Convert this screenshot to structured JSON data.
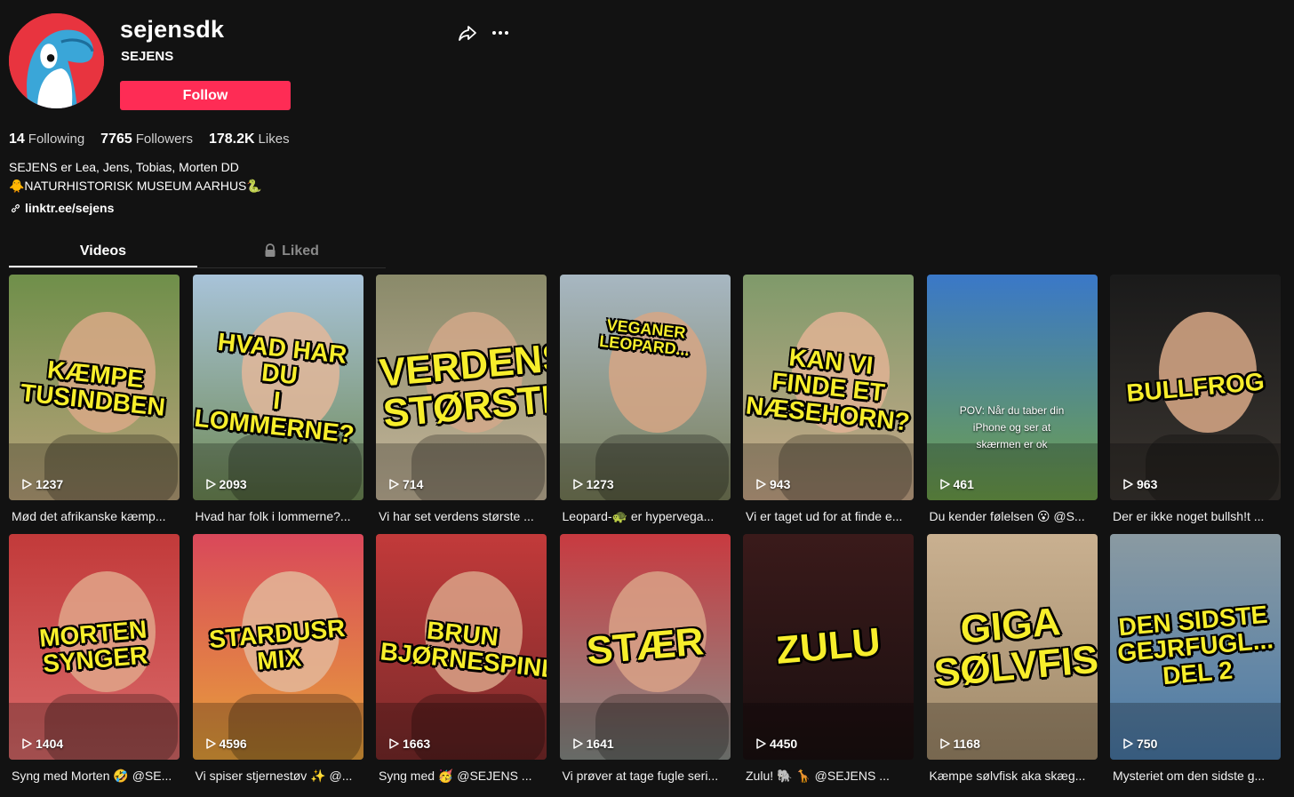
{
  "profile": {
    "username": "sejensdk",
    "nickname": "SEJENS",
    "follow_label": "Follow",
    "following_count": "14",
    "following_label": "Following",
    "followers_count": "7765",
    "followers_label": "Followers",
    "likes_count": "178.2K",
    "likes_label": "Likes",
    "bio_line1": "SEJENS er Lea, Jens, Tobias, Morten DD",
    "bio_line2": "🐥NATURHISTORISK MUSEUM AARHUS🐍",
    "link": "linktr.ee/sejens"
  },
  "tabs": {
    "videos": "Videos",
    "liked": "Liked"
  },
  "colors": {
    "accent": "#fe2c55",
    "background": "#121212",
    "overlay_text": "#f7ee2b"
  },
  "videos": [
    {
      "overlay": "KÆMPE\nTUSINDBEN",
      "views": "1237",
      "desc": "Mød det afrikanske kæmp..."
    },
    {
      "overlay": "HVAD HAR DU\nI LOMMERNE?",
      "views": "2093",
      "desc": "Hvad har folk i lommerne?..."
    },
    {
      "overlay": "VERDENS\nSTØRSTE!!!",
      "views": "714",
      "desc": "Vi har set verdens største ..."
    },
    {
      "overlay": "VEGANER\nLEOPARD...",
      "views": "1273",
      "desc": "Leopard-🐢 er hypervega..."
    },
    {
      "overlay": "KAN VI FINDE ET\nNÆSEHORN?",
      "views": "943",
      "desc": "Vi er taget ud for at finde e..."
    },
    {
      "overlay": "POV: Når du taber din\niPhone og ser at\nskærmen er ok",
      "views": "461",
      "desc": "Du kender følelsen 😮 @S..."
    },
    {
      "overlay": "BULLFROG",
      "views": "963",
      "desc": "Der er ikke noget bullsh!t ..."
    },
    {
      "overlay": "MORTEN SYNGER",
      "views": "1404",
      "desc": "Syng med Morten 🤣 @SE..."
    },
    {
      "overlay": "STARDUSR MIX",
      "views": "4596",
      "desc": "Vi spiser stjernestøv ✨ @..."
    },
    {
      "overlay": "BRUN\nBJØRNESPINDER",
      "views": "1663",
      "desc": "Syng med 🥳 @SEJENS ..."
    },
    {
      "overlay": "STÆR",
      "views": "1641",
      "desc": "Vi prøver at tage fugle seri..."
    },
    {
      "overlay": "ZULU",
      "views": "4450",
      "desc": "Zulu! 🐘 🦒 @SEJENS ..."
    },
    {
      "overlay": "GIGA\nSØLVFISK",
      "views": "1168",
      "desc": "Kæmpe sølvfisk aka skæg..."
    },
    {
      "overlay": "DEN SIDSTE\nGEJRFUGL...\nDEL 2",
      "views": "750",
      "desc": "Mysteriet om den sidste g..."
    }
  ]
}
